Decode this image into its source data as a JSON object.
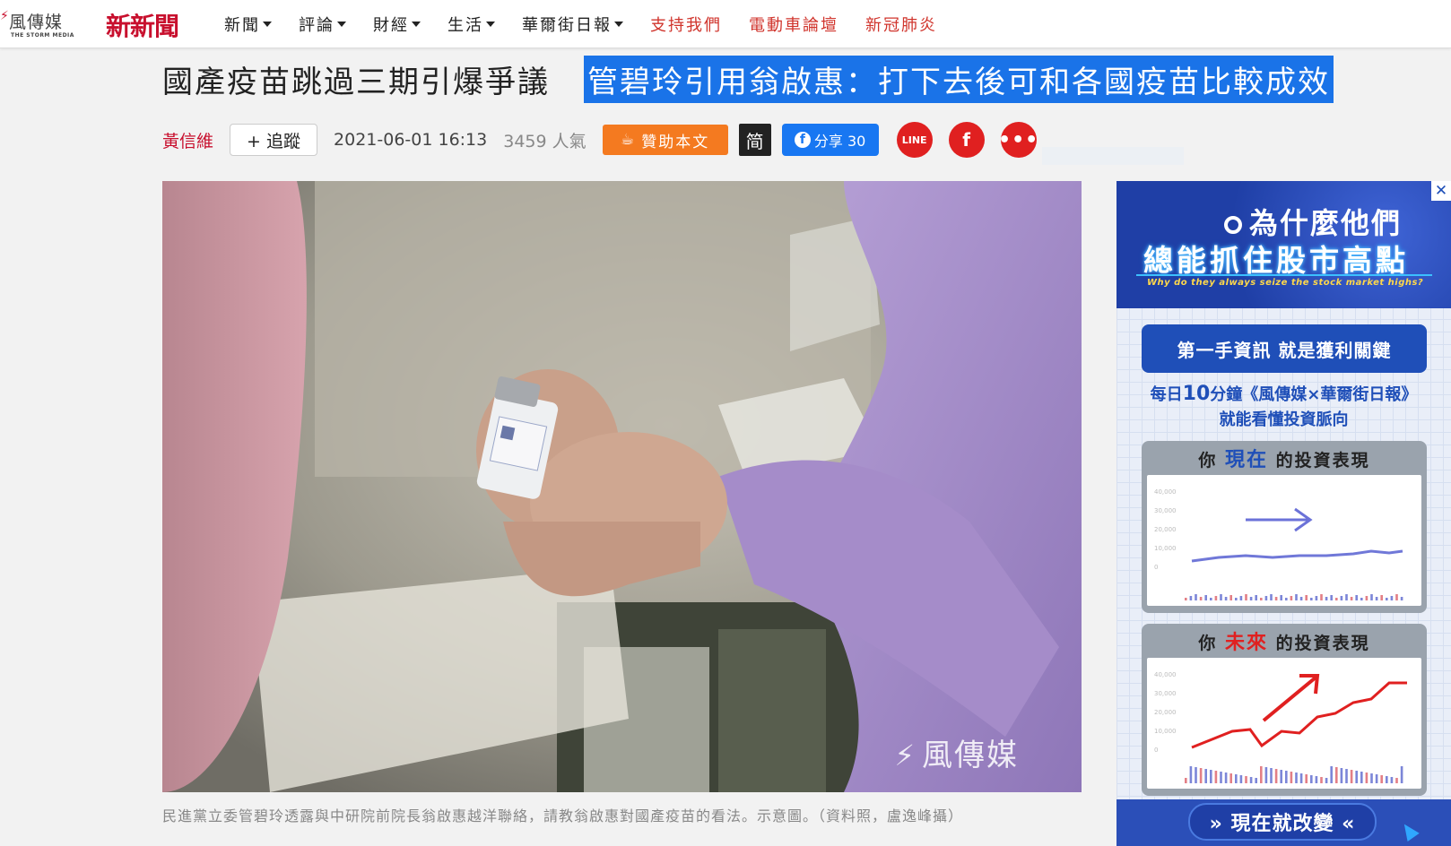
{
  "header": {
    "logo_text": "風傳媒",
    "logo_sub": "THE STORM MEDIA",
    "brand2": "新新聞",
    "nav": [
      {
        "label": "新聞",
        "dropdown": true,
        "red": false
      },
      {
        "label": "評論",
        "dropdown": true,
        "red": false
      },
      {
        "label": "財經",
        "dropdown": true,
        "red": false
      },
      {
        "label": "生活",
        "dropdown": true,
        "red": false
      },
      {
        "label": "華爾街日報",
        "dropdown": true,
        "red": false
      },
      {
        "label": "支持我們",
        "dropdown": false,
        "red": true
      },
      {
        "label": "電動車論壇",
        "dropdown": false,
        "red": true
      },
      {
        "label": "新冠肺炎",
        "dropdown": false,
        "red": true
      }
    ]
  },
  "article": {
    "title_main": "國產疫苗跳過三期引爆爭議",
    "title_sub": "管碧玲引用翁啟惠：打下去後可和各國疫苗比較成效",
    "author": "黃信維",
    "follow_label": "+ 追蹤",
    "date": "2021-06-01 16:13",
    "views": "3459 人氣",
    "sponsor_label": "贊助本文",
    "simplified_label": "简",
    "fb_share_label": "分享 30",
    "line_label": "LINE",
    "fb_label": "f",
    "more_label": "•••",
    "image_watermark": "風傳媒",
    "caption": "民進黨立委管碧玲透露與中研院前院長翁啟惠越洋聯絡，請教翁啟惠對國產疫苗的看法。示意圖。（資料照，盧逸峰攝）"
  },
  "ad": {
    "close_label": "✕",
    "headline1": "為什麼他們",
    "headline2": "總能抓住股市高點",
    "headline3": "Why do they always seize the stock market highs?",
    "pill": "第一手資訊 就是獲利關鍵",
    "desc1_prefix": "每日",
    "desc1_big": "10",
    "desc1_suffix": "分鐘《風傳媒×華爾街日報》",
    "desc2": "就能看懂投資脈向",
    "card1_pre": "你",
    "card1_hl": "現在",
    "card1_post": "的投資表現",
    "card2_pre": "你",
    "card2_hl": "未來",
    "card2_post": "的投資表現",
    "y_ticks": [
      "40,000",
      "30,000",
      "20,000",
      "10,000",
      "0"
    ],
    "cta": "» 現在就改變 «"
  }
}
